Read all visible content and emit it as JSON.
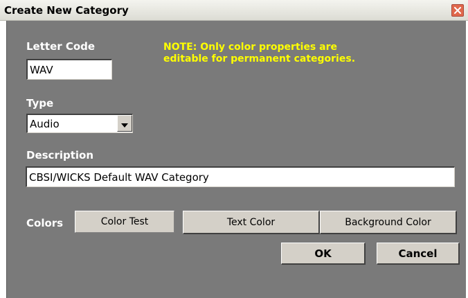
{
  "window": {
    "title": "Create New Category"
  },
  "form": {
    "letter_code_label": "Letter Code",
    "letter_code_value": "WAV",
    "note": "NOTE: Only color properties are editable for permanent categories.",
    "type_label": "Type",
    "type_value": "Audio",
    "description_label": "Description",
    "description_value": "CBSI/WICKS Default WAV Category",
    "colors_label": "Colors",
    "color_test_label": "Color Test"
  },
  "buttons": {
    "text_color": "Text Color",
    "background_color": "Background Color",
    "ok": "OK",
    "cancel": "Cancel"
  },
  "icons": {
    "close": "close-icon",
    "dropdown": "chevron-down-icon"
  },
  "colors": {
    "client_background": "#7a7a7a",
    "note_text": "#ffff00",
    "label_text": "#ffffff",
    "button_face": "#d4d0c8",
    "close_button": "#e0684c"
  }
}
